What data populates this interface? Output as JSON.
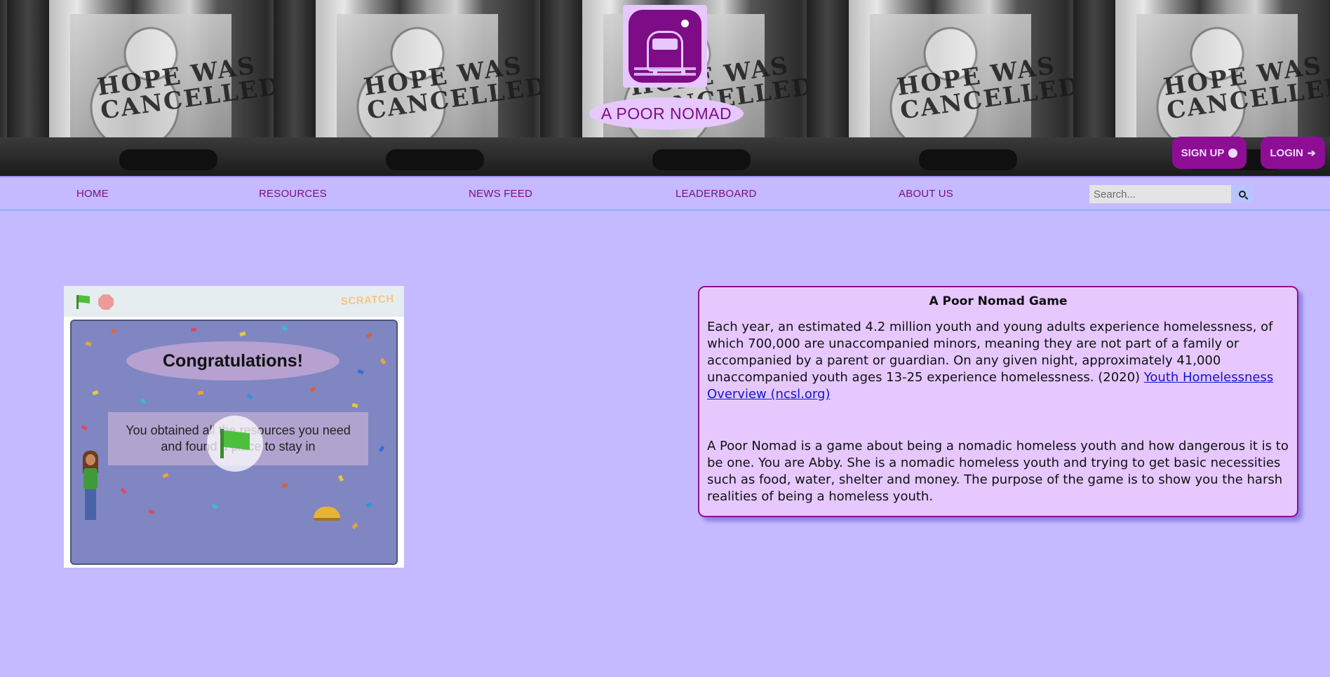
{
  "header": {
    "brand_name": "A POOR NOMAD",
    "logo_icon": "bus-moon-logo",
    "banner_graffiti": "HOPE WAS CANCELLED",
    "signup_label": "SIGN UP",
    "signup_icon": "user-circle-icon",
    "login_label": "LOGIN",
    "login_icon": "sign-in-icon"
  },
  "nav": {
    "items": [
      {
        "label": "HOME"
      },
      {
        "label": "RESOURCES"
      },
      {
        "label": "NEWS FEED"
      },
      {
        "label": "LEADERBOARD"
      },
      {
        "label": "ABOUT US"
      }
    ],
    "search": {
      "placeholder": "Search...",
      "value": "",
      "icon": "search-icon"
    }
  },
  "game": {
    "logo_text": "SCRATCH",
    "title": "Congratulations!",
    "message": "You obtained all the resources you need and found a place to stay in",
    "controls": {
      "green_flag": "green-flag-icon",
      "stop": "stop-icon",
      "play_overlay": "green-flag-icon"
    }
  },
  "info": {
    "title": "A Poor Nomad Game",
    "paragraph1_text": "Each year, an estimated 4.2 million youth and young adults experience homelessness, of which 700,000 are unaccompanied minors, meaning they are not part of a family or accompanied by a parent or guardian. On any given night, approximately 41,000 unaccompanied youth ages 13-25 experience homelessness. (2020) ",
    "paragraph1_link": "Youth Homelessness Overview (ncsl.org)",
    "paragraph2_text": "A Poor Nomad is a game about being a nomadic homeless youth and how dangerous it is to be one. You are Abby. She is a nomadic homeless youth and trying to get basic necessities such as food, water, shelter and money. The purpose of the game is to show you the harsh realities of being a homeless youth."
  },
  "colors": {
    "page_bg": "#c5baff",
    "brand_purple": "#7e0c86",
    "button_purple": "#8d0e95",
    "card_bg": "#e6c8ff",
    "link_blue": "#0c18cc"
  }
}
